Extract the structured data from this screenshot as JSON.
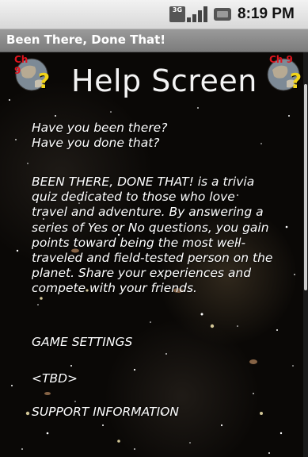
{
  "status_bar": {
    "network": "3G",
    "time": "8:19 PM"
  },
  "app": {
    "title": "Been There, Done That!"
  },
  "header": {
    "title": "Help Screen",
    "badge_left": "Ch 9",
    "badge_right": "Ch 9",
    "badge_symbol": "?"
  },
  "content": {
    "intro_lines": [
      "Have you been there?",
      "Have you done that?"
    ],
    "description_lines": [
      "BEEN THERE, DONE THAT! is a trivia",
      "quiz dedicated to those who love",
      "travel and adventure. By answering a",
      "series of Yes or No questions, you gain",
      "points toward being the most well-",
      "traveled and field-tested person on the",
      "planet. Share your experiences and",
      "compete with your friends."
    ],
    "game_settings_heading": "GAME SETTINGS",
    "game_settings_value": "<TBD>",
    "support_heading": "SUPPORT INFORMATION"
  },
  "colors": {
    "title_bar": "#8a8a8a",
    "status_bar": "#e4e4e4",
    "text": "#ffffff",
    "badge_text": "#e0141e",
    "badge_symbol": "#f2d41a"
  },
  "icons": {
    "network": "network-3g-icon",
    "signal": "signal-strength-icon",
    "battery": "battery-icon",
    "globe": "earth-globe-icon"
  }
}
